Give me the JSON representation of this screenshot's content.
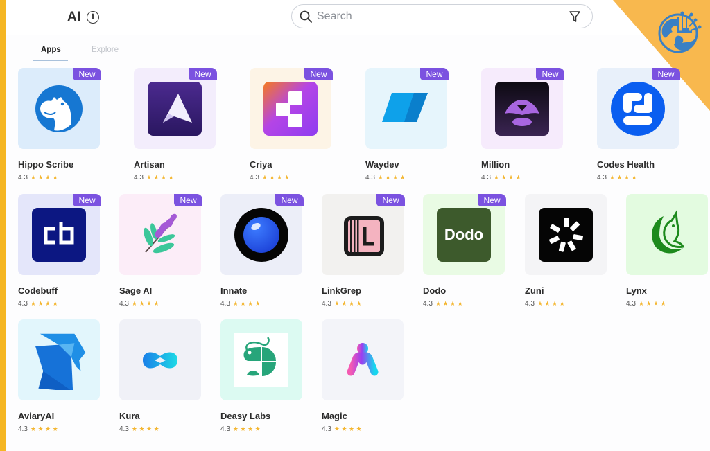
{
  "header": {
    "title": "AI",
    "info_icon": "info-circle-icon",
    "search": {
      "placeholder": "Search",
      "value": "",
      "icon": "search-icon",
      "filter_icon": "filter-funnel-icon"
    },
    "corner_logo": "globe-circuit-logo-icon"
  },
  "colors": {
    "accent_strip": "#f5b623",
    "corner_banner": "#f8b84e",
    "new_badge": "#7b52e0",
    "star": "#f4b733",
    "tab_underline": "#a9c1db"
  },
  "tabs": [
    {
      "label": "Apps",
      "active": true
    },
    {
      "label": "Explore",
      "active": false
    }
  ],
  "star_glyph": "★★★★",
  "apps": [
    {
      "name": "Hippo Scribe",
      "rating": "4.3",
      "stars": 4,
      "is_new": true,
      "badge": "New",
      "icon": "hippo-icon"
    },
    {
      "name": "Artisan",
      "rating": "4.3",
      "stars": 4,
      "is_new": true,
      "badge": "New",
      "icon": "artisan-triangle-icon"
    },
    {
      "name": "Criya",
      "rating": "4.3",
      "stars": 4,
      "is_new": true,
      "badge": "New",
      "icon": "criya-blocks-icon"
    },
    {
      "name": "Waydev",
      "rating": "4.3",
      "stars": 4,
      "is_new": true,
      "badge": "New",
      "icon": "waydev-parallelogram-icon"
    },
    {
      "name": "Million",
      "rating": "4.3",
      "stars": 4,
      "is_new": true,
      "badge": "New",
      "icon": "million-lion-icon"
    },
    {
      "name": "Codes Health",
      "rating": "4.3",
      "stars": 4,
      "is_new": true,
      "badge": "New",
      "icon": "codes-health-dots-icon"
    },
    {
      "name": "Codebuff",
      "rating": "4.3",
      "stars": 4,
      "is_new": true,
      "badge": "New",
      "icon": "codebuff-cb-icon"
    },
    {
      "name": "Sage AI",
      "rating": "4.3",
      "stars": 4,
      "is_new": true,
      "badge": "New",
      "icon": "sage-leaf-icon"
    },
    {
      "name": "Innate",
      "rating": "4.3",
      "stars": 4,
      "is_new": true,
      "badge": "New",
      "icon": "innate-orb-icon"
    },
    {
      "name": "LinkGrep",
      "rating": "4.3",
      "stars": 4,
      "is_new": true,
      "badge": "New",
      "icon": "linkgrep-l-icon"
    },
    {
      "name": "Dodo",
      "rating": "4.3",
      "stars": 4,
      "is_new": true,
      "badge": "New",
      "icon": "dodo-wordmark-icon",
      "logo_text": "Dodo"
    },
    {
      "name": "Zuni",
      "rating": "4.3",
      "stars": 4,
      "is_new": false,
      "badge": "",
      "icon": "zuni-spinner-icon"
    },
    {
      "name": "Lynx",
      "rating": "4.3",
      "stars": 4,
      "is_new": false,
      "badge": "",
      "icon": "lynx-bird-icon"
    },
    {
      "name": "AviaryAI",
      "rating": "4.3",
      "stars": 4,
      "is_new": false,
      "badge": "",
      "icon": "aviary-bird-icon"
    },
    {
      "name": "Kura",
      "rating": "4.3",
      "stars": 4,
      "is_new": false,
      "badge": "",
      "icon": "kura-infinity-icon"
    },
    {
      "name": "Deasy Labs",
      "rating": "4.3",
      "stars": 4,
      "is_new": false,
      "badge": "",
      "icon": "deasy-shrimp-icon"
    },
    {
      "name": "Magic",
      "rating": "4.3",
      "stars": 4,
      "is_new": false,
      "badge": "",
      "icon": "magic-m-icon"
    }
  ]
}
